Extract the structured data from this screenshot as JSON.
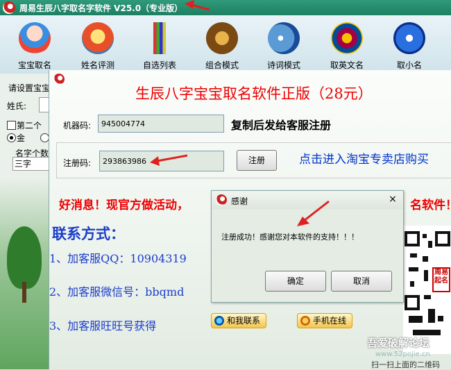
{
  "app": {
    "title": "周易生辰八字取名字软件 V25.0（专业版）"
  },
  "toolbar": {
    "items": [
      {
        "label": "宝宝取名"
      },
      {
        "label": "姓名评测"
      },
      {
        "label": "自选列表"
      },
      {
        "label": "组合模式"
      },
      {
        "label": "诗词模式"
      },
      {
        "label": "取英文名"
      },
      {
        "label": "取小名"
      }
    ]
  },
  "left_panel": {
    "settings_label": "请设置宝宝",
    "surname_label": "姓氏:",
    "second_checkbox_label": "第二个",
    "radio_gold_label": "金",
    "name_count_label": "名字个数",
    "name_count_value": "三字"
  },
  "registration": {
    "heading": "生辰八字宝宝取名软件正版（28元）",
    "machine_code_label": "机器码:",
    "machine_code_value": "945004774",
    "copy_hint": "复制后发给客服注册",
    "reg_code_label": "注册码:",
    "reg_code_value": "293863986",
    "register_button": "注册",
    "taobao_link": "点击进入淘宝专卖店购买",
    "good_news": "好消息！现官方做活动，",
    "good_news_tail": "名软件！",
    "contact_title": "联系方式：",
    "contact_qq": "1、加客服QQ：10904319",
    "contact_wechat": "2、加客服微信号：bbqmd",
    "contact_wangwang": "3、加客服旺旺号获得",
    "contact_me_button": "和我联系",
    "online_button": "手机在线",
    "qr_stamp": "周易起名",
    "scan_tip": "扫一扫上面的二维码",
    "bbs_watermark": "吾爱破解论坛",
    "bbs_url": "www.52pojie.cn"
  },
  "dialog": {
    "title": "感谢",
    "close": "×",
    "message": "注册成功！感谢您对本软件的支持！！！",
    "ok_button": "确定",
    "cancel_button": "取消"
  },
  "colors": {
    "title_bar": "#1e7f63",
    "heading_red": "#e00000",
    "contact_blue": "#1a3ccc",
    "link_blue": "#0033cc",
    "annotation_red": "#e02020"
  }
}
